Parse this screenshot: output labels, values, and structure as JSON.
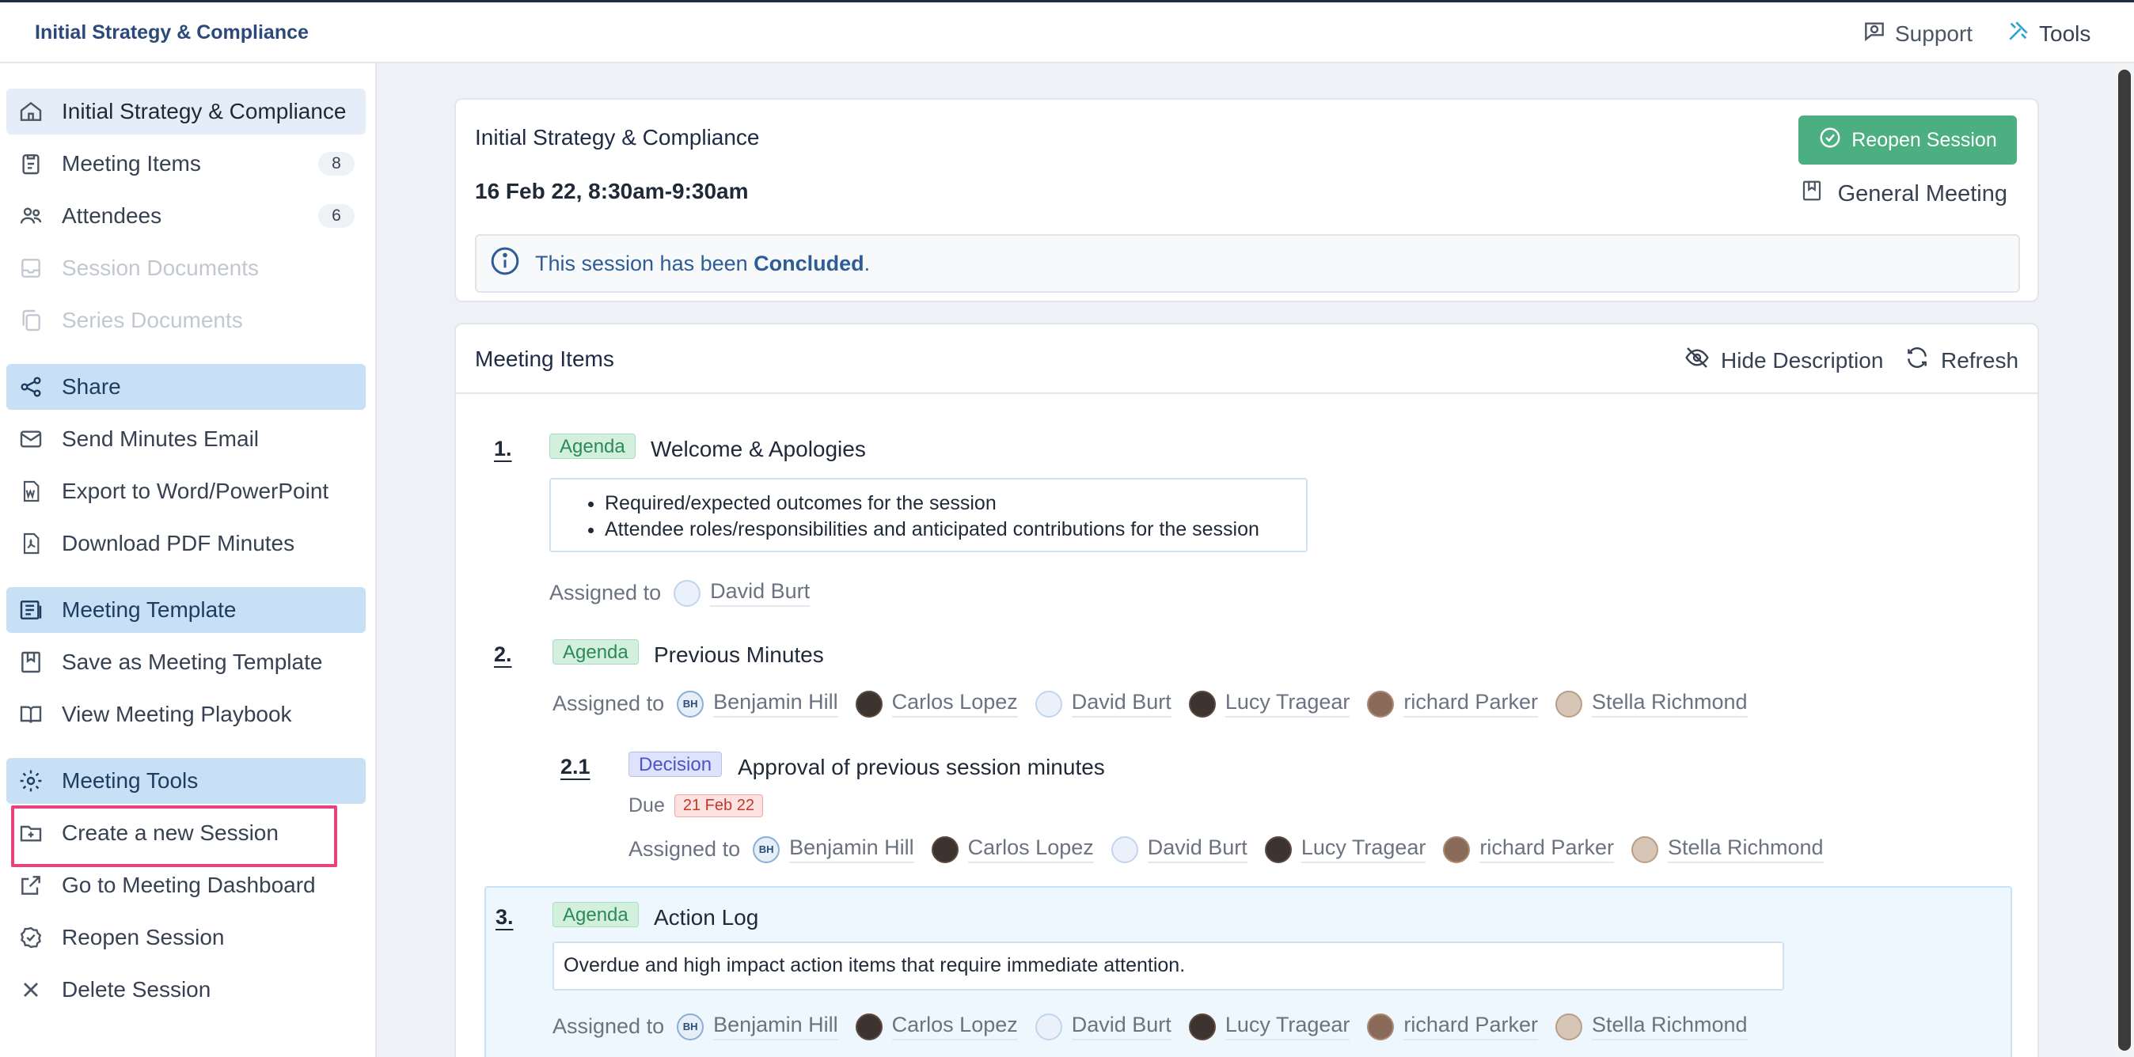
{
  "topbar": {
    "app_title": "Initial Strategy & Compliance",
    "support_label": "Support",
    "tools_label": "Tools"
  },
  "sidebar": {
    "items": [
      {
        "label": "Initial Strategy & Compliance",
        "icon": "home-icon"
      },
      {
        "label": "Meeting Items",
        "icon": "clipboard-icon",
        "badge": "8"
      },
      {
        "label": "Attendees",
        "icon": "users-icon",
        "badge": "6"
      },
      {
        "label": "Session Documents",
        "icon": "inbox-icon",
        "disabled": true
      },
      {
        "label": "Series Documents",
        "icon": "copy-icon",
        "disabled": true
      },
      {
        "label": "Share",
        "icon": "share-icon",
        "section": true
      },
      {
        "label": "Send Minutes Email",
        "icon": "mail-icon"
      },
      {
        "label": "Export to Word/PowerPoint",
        "icon": "word-file-icon"
      },
      {
        "label": "Download PDF Minutes",
        "icon": "pdf-file-icon"
      },
      {
        "label": "Meeting Template",
        "icon": "template-icon",
        "section": true
      },
      {
        "label": "Save as Meeting Template",
        "icon": "bookmark-icon"
      },
      {
        "label": "View Meeting Playbook",
        "icon": "book-icon"
      },
      {
        "label": "Meeting Tools",
        "icon": "gear-icon",
        "section": true
      },
      {
        "label": "Create a new Session",
        "icon": "folder-plus-icon"
      },
      {
        "label": "Go to Meeting Dashboard",
        "icon": "external-link-icon"
      },
      {
        "label": "Reopen Session",
        "icon": "check-circle-icon"
      },
      {
        "label": "Delete Session",
        "icon": "close-icon"
      }
    ]
  },
  "session": {
    "title": "Initial Strategy & Compliance",
    "date": "16 Feb 22, 8:30am-9:30am",
    "reopen_label": "Reopen Session",
    "meeting_type": "General Meeting",
    "notice_prefix": "This session has been ",
    "notice_status": "Concluded",
    "notice_suffix": "."
  },
  "meeting_items": {
    "title": "Meeting Items",
    "hide_description_label": "Hide Description",
    "refresh_label": "Refresh",
    "assigned_label": "Assigned to",
    "due_label": "Due",
    "items": [
      {
        "number": "1.",
        "tag": "Agenda",
        "title": "Welcome & Apologies",
        "description": [
          "Required/expected outcomes for the session",
          "Attendee roles/responsibilities and anticipated contributions for the session"
        ],
        "assignees": [
          "David Burt"
        ]
      },
      {
        "number": "2.",
        "tag": "Agenda",
        "title": "Previous Minutes",
        "assignees": [
          "Benjamin Hill",
          "Carlos Lopez",
          "David Burt",
          "Lucy Tragear",
          "richard Parker",
          "Stella Richmond"
        ]
      },
      {
        "number": "2.1",
        "tag": "Decision",
        "title": "Approval of previous session minutes",
        "due": "21 Feb 22",
        "assignees": [
          "Benjamin Hill",
          "Carlos Lopez",
          "David Burt",
          "Lucy Tragear",
          "richard Parker",
          "Stella Richmond"
        ]
      },
      {
        "number": "3.",
        "tag": "Agenda",
        "title": "Action Log",
        "description_text": "Overdue and high impact action items that require immediate attention.",
        "assignees": [
          "Benjamin Hill",
          "Carlos Lopez",
          "David Burt",
          "Lucy Tragear",
          "richard Parker",
          "Stella Richmond"
        ]
      }
    ]
  },
  "avatar_initials": {
    "benjamin_hill": "BH"
  }
}
